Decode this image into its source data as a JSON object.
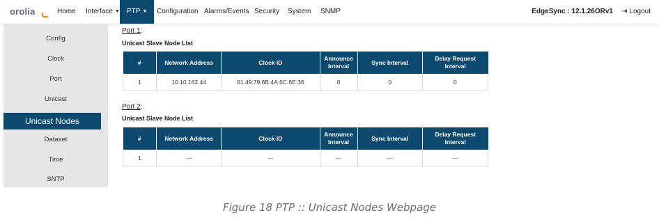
{
  "app": {
    "logo_text_main": "orolia",
    "logo_accent_char": "",
    "device": "EdgeSync : 12.1.26ORv1",
    "logout_label": "Logout"
  },
  "nav": [
    {
      "label": "Home"
    },
    {
      "label": "Interface",
      "dropdown": true
    },
    {
      "label": "PTP",
      "dropdown": true,
      "active": true
    },
    {
      "label": "Configuration"
    },
    {
      "label": "Alarms/Events"
    },
    {
      "label": "Security"
    },
    {
      "label": "System"
    },
    {
      "label": "SNMP"
    }
  ],
  "sidebar": {
    "items": [
      {
        "label": "Config"
      },
      {
        "label": "Clock"
      },
      {
        "label": "Port"
      },
      {
        "label": "Unicast"
      },
      {
        "label": "Unicast Nodes",
        "active": true
      },
      {
        "label": "Dataset"
      },
      {
        "label": "Time"
      },
      {
        "label": "SNTP"
      }
    ]
  },
  "columns": [
    "#",
    "Network Address",
    "Clock ID",
    "Announce Interval",
    "Sync Interval",
    "Delay Request Interval"
  ],
  "ports": [
    {
      "label": "Port 1",
      "suffix": ":",
      "title": "Unicast Slave Node List",
      "rows": [
        [
          "1",
          "10.10.162.44",
          "61:49:79:6B:4A:6C:6E:36",
          "0",
          "0",
          "0"
        ]
      ]
    },
    {
      "label": "Port 2",
      "suffix": ":",
      "title": "Unicast Slave Node List",
      "rows": [
        [
          "1",
          "---",
          "---",
          "---",
          "---",
          "---"
        ]
      ]
    }
  ],
  "caption": "Figure 18 PTP :: Unicast Nodes Webpage",
  "colors": {
    "primary": "#0b4a6e",
    "sidebar_bg": "#e6e6e6",
    "logo_accent": "#f08a24"
  }
}
